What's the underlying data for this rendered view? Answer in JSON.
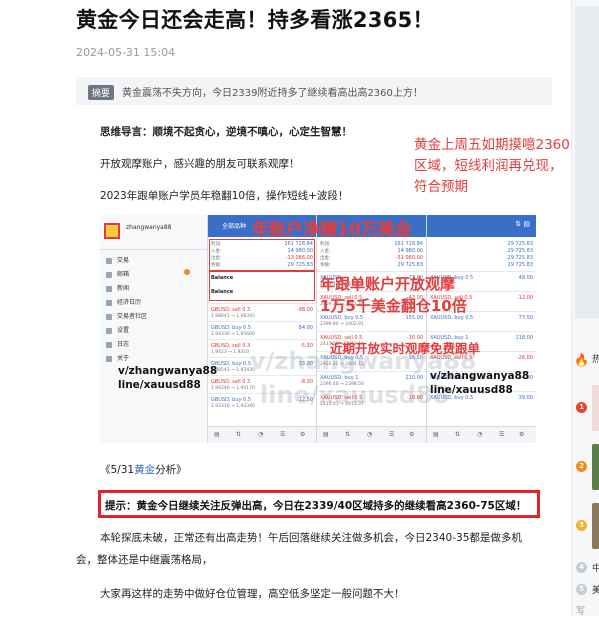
{
  "article": {
    "title": "黄金今日还会走高！持多看涨2365！",
    "date": "2024-05-31 15:04",
    "summary_tag": "摘要",
    "summary_text": "黄金震荡不失方向，今日2339附近持多了继续看高出高2360上方！",
    "para1": "思维导言：顺境不起贪心，逆境不嗔心，心定生智慧！",
    "para2": "开放观摩账户，感兴趣的朋友可联系观摩！",
    "para3": "2023年跟单账户学员年稳翻10倍，操作短线+波段！",
    "red_note": "黄金上周五如期摸噫2360区域，短线利润再兑现，符合预期",
    "analysis_prefix": "《5/31",
    "analysis_kw": "黄金",
    "analysis_suffix": "分析》",
    "tip": "提示：黄金今日继续关注反弹出高，今日在2339/40区域持多的继续看高2360-75区域！",
    "para4": "本轮探底未破，正常还有出高走势！午后回落继续关注做多机会，今日2340-35都是做多机",
    "para4b": "会，整体还是中继震荡格局，",
    "para5": "大家再这样的走势中做好仓位管理，高空低多坚定一般问题不大！"
  },
  "shot": {
    "overlay1": "年账户净赚10万美金",
    "overlay2": "年跟单账户开放观摩",
    "overlay3": "1万5千美金翻仓10倍",
    "overlay4": "近期开放实时观摩免费跟单",
    "wechat_left_1": "v/zhangwanya88",
    "wechat_left_2": "line/xauusd88",
    "wechat_right_1": "v/zhangwanya88",
    "wechat_right_2": "line/xauusd88",
    "watermark1": "v/zhangwanya88",
    "watermark2": "line/xauusd88",
    "p1_user": "zhangwanya88",
    "p1_menu": [
      "交易",
      "邮箱",
      "新闻",
      "经济日历",
      "交易者社区",
      "设置",
      "日志",
      "关于"
    ],
    "p2_header": "全部品种",
    "p2_balance": "Balance",
    "p3_symbol": "XAUUSD",
    "p4_values": [
      "29 725.83",
      "29 725.83",
      "29 725.83",
      "29 725.83"
    ],
    "p2_values": [
      "161 728.84",
      "14 980.00",
      "-13 066.00",
      "22 720.00",
      "29 725.83"
    ],
    "p3_values": [
      "161 728.84",
      "14 980.00",
      "-51 060.00",
      "11 750.00",
      "29 725.83"
    ]
  },
  "sidebar": {
    "ranks": [
      "1",
      "2",
      "3",
      "4",
      "5"
    ],
    "colors": {
      "rank1": "#e8422a",
      "rank2": "#f08c1a",
      "rank3": "#f0b323"
    }
  }
}
